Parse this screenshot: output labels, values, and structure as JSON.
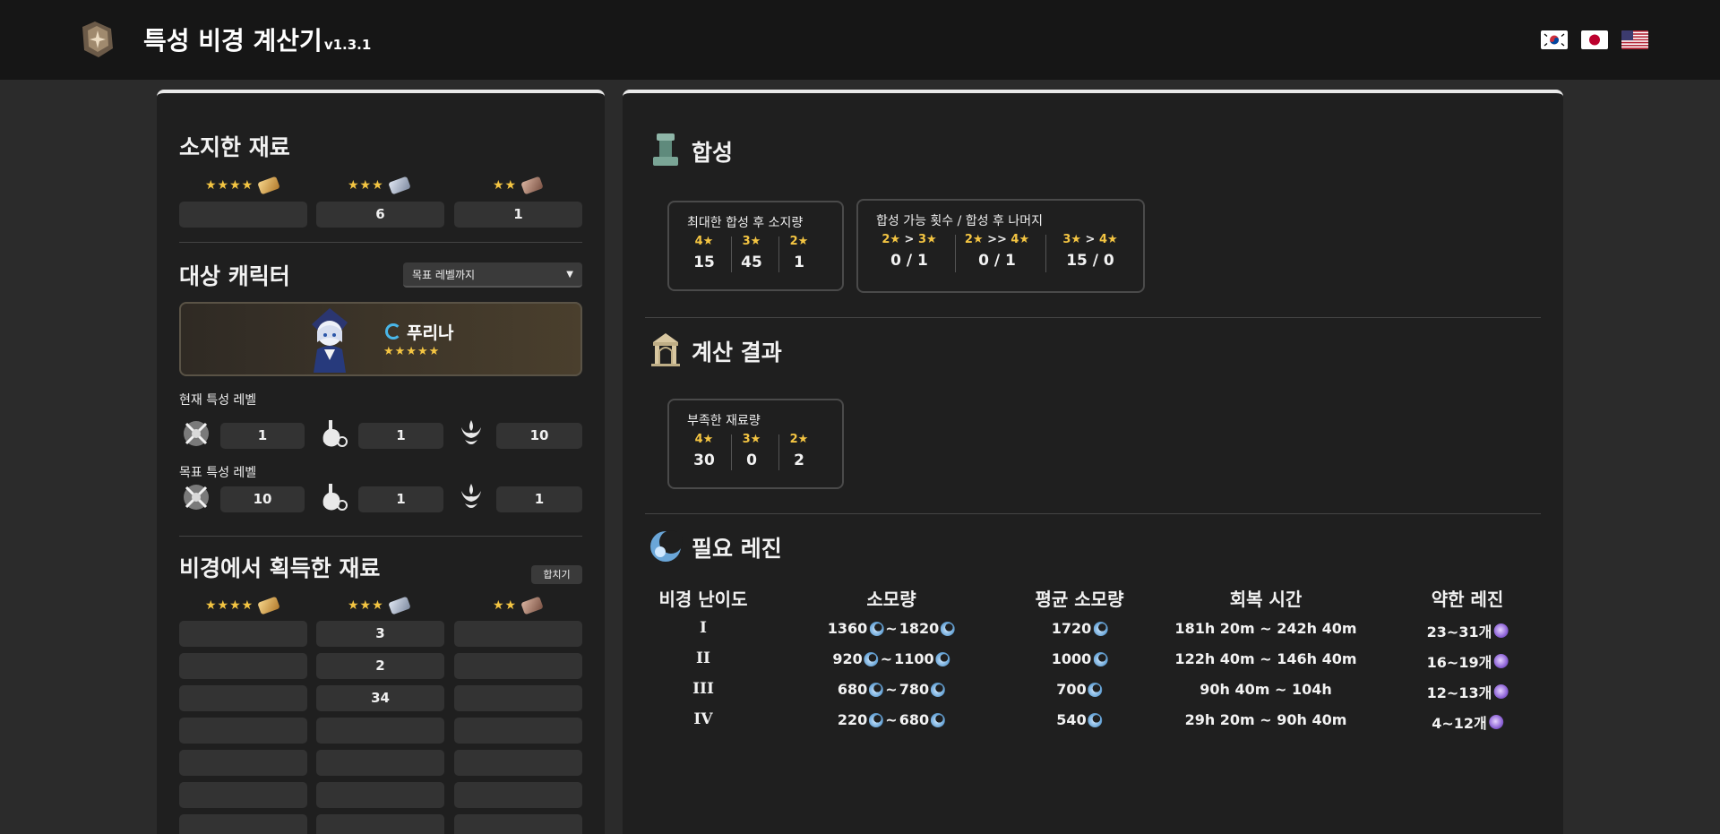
{
  "header": {
    "title": "특성 비경 계산기",
    "version": "v1.3.1",
    "languages": [
      {
        "name": "korean-flag-icon"
      },
      {
        "name": "japanese-flag-icon"
      },
      {
        "name": "us-flag-icon"
      }
    ]
  },
  "owned": {
    "title": "소지한 재료",
    "tiers": [
      {
        "stars": "★★★★",
        "value": ""
      },
      {
        "stars": "★★★",
        "value": "6"
      },
      {
        "stars": "★★",
        "value": "1"
      }
    ]
  },
  "target": {
    "title": "대상 캐릭터",
    "mode_select": "목표 레벨까지",
    "character_name": "푸리나",
    "character_stars": "★★★★★",
    "current_label": "현재 특성 레벨",
    "current_levels": [
      "1",
      "1",
      "10"
    ],
    "goal_label": "목표 특성 레벨",
    "goal_levels": [
      "10",
      "1",
      "1"
    ]
  },
  "domain_drops": {
    "title": "비경에서 획득한 재료",
    "merge_button": "합치기",
    "tiers": [
      "★★★★",
      "★★★",
      "★★"
    ],
    "rows": [
      [
        "",
        "3",
        ""
      ],
      [
        "",
        "2",
        ""
      ],
      [
        "",
        "34",
        ""
      ],
      [
        "",
        "",
        ""
      ],
      [
        "",
        "",
        ""
      ],
      [
        "",
        "",
        ""
      ],
      [
        "",
        "",
        ""
      ]
    ]
  },
  "synthesis": {
    "title": "합성",
    "max_card": {
      "title": "최대한 합성 후 소지량",
      "cols": [
        {
          "stars": "4★",
          "value": "15"
        },
        {
          "stars": "3★",
          "value": "45"
        },
        {
          "stars": "2★",
          "value": "1"
        }
      ]
    },
    "count_card": {
      "title": "합성 가능 횟수 / 합성 후 나머지",
      "cols": [
        {
          "from": "2★",
          "op": " > ",
          "to": "3★",
          "value": "0 / 1"
        },
        {
          "from": "2★",
          "op": " >> ",
          "to": "4★",
          "value": "0 / 1"
        },
        {
          "from": "3★",
          "op": " > ",
          "to": "4★",
          "value": "15 / 0"
        }
      ]
    }
  },
  "result": {
    "title": "계산 결과",
    "card": {
      "title": "부족한 재료량",
      "cols": [
        {
          "stars": "4★",
          "value": "30"
        },
        {
          "stars": "3★",
          "value": "0"
        },
        {
          "stars": "2★",
          "value": "2"
        }
      ]
    }
  },
  "resin": {
    "title": "필요 레진",
    "headers": [
      "비경 난이도",
      "소모량",
      "평균 소모량",
      "회복 시간",
      "약한 레진"
    ],
    "rows": [
      {
        "level": "I",
        "min": "1360",
        "sep": "~",
        "max": "1820",
        "avg": "1720",
        "time": "181h 20m ~ 242h 40m",
        "fragile": "23~31개"
      },
      {
        "level": "II",
        "min": "920",
        "sep": "~",
        "max": "1100",
        "avg": "1000",
        "time": "122h 40m ~ 146h 40m",
        "fragile": "16~19개"
      },
      {
        "level": "III",
        "min": "680",
        "sep": "~",
        "max": "780",
        "avg": "700",
        "time": "90h 40m ~ 104h",
        "fragile": "12~13개"
      },
      {
        "level": "IV",
        "min": "220",
        "sep": "~",
        "max": "680",
        "avg": "540",
        "time": "29h 20m ~ 90h 40m",
        "fragile": "4~12개"
      }
    ]
  },
  "colors": {
    "accent_star": "#f4c542",
    "background": "#2b2b2b",
    "panel": "#1f1f1f",
    "header": "#161616"
  }
}
